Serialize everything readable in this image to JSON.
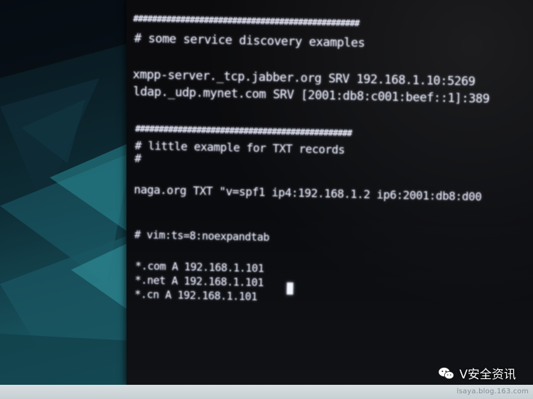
{
  "terminal": {
    "lines": [
      "################################################",
      "# some service discovery examples",
      "xmpp-server._tcp.jabber.org SRV 192.168.1.10:5269",
      "ldap._udp.mynet.com SRV [2001:db8:c001:beef::1]:389",
      "##############################################",
      "# little example for TXT records",
      "#",
      "naga.org TXT \"v=spf1 ip4:192.168.1.2 ip6:2001:db8:d00",
      "# vim:ts=8:noexpandtab",
      "*.com A 192.168.1.101",
      "*.net A 192.168.1.101",
      "*.cn A 192.168.1.101"
    ]
  },
  "watermark": {
    "label": "V安全资讯",
    "icon": "wechat-icon"
  },
  "footer": {
    "url": "lsaya.blog.163.com"
  },
  "colors": {
    "terminal_bg": "#0b0b0d",
    "terminal_text": "#eef0ff",
    "desktop_teal": "#2a8a96",
    "bezel": "#cdd5d8"
  }
}
